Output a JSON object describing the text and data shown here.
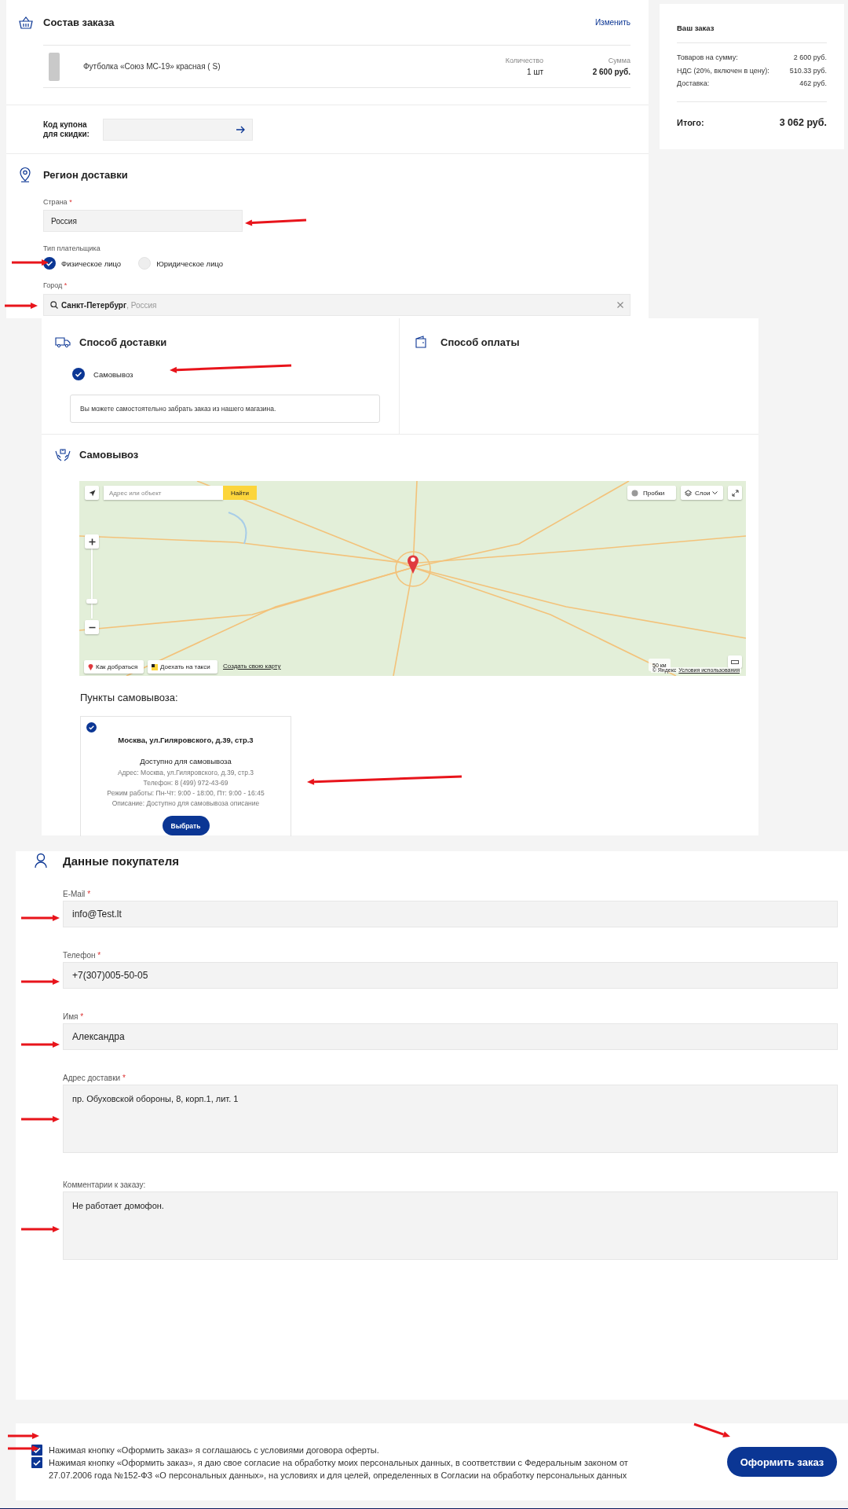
{
  "order": {
    "title": "Состав заказа",
    "edit_link": "Изменить",
    "items": [
      {
        "name": "Футболка «Союз МС-19» красная ( S)",
        "quantity_label": "Количество",
        "quantity": "1 шт",
        "sum_label": "Сумма",
        "sum": "2 600 руб."
      }
    ]
  },
  "coupon": {
    "label": "Код купона для скидки:"
  },
  "region": {
    "title": "Регион доставки",
    "country": {
      "label": "Страна",
      "required_mark": "*",
      "value": "Россия"
    },
    "payer_type": {
      "label": "Тип плательщика",
      "options": [
        {
          "label": "Физическое лицо",
          "selected": true
        },
        {
          "label": "Юридическое лицо",
          "selected": false
        }
      ]
    },
    "city": {
      "label": "Город",
      "required_mark": "*",
      "value": "Санкт-Петербург",
      "hint": ", Россия"
    }
  },
  "summary": {
    "title": "Ваш заказ",
    "rows": [
      {
        "label": "Товаров на сумму:",
        "value": "2 600 руб."
      },
      {
        "label": "НДС (20%, включен в цену):",
        "value": "510.33 руб."
      },
      {
        "label": "Доставка:",
        "value": "462 руб."
      }
    ],
    "total_label": "Итого:",
    "total": "3 062 руб."
  },
  "delivery": {
    "title": "Способ доставки",
    "options": [
      {
        "label": "Самовывоз",
        "selected": true
      }
    ],
    "description": "Вы можете самостоятельно забрать заказ из нашего магазина."
  },
  "payment": {
    "title": "Способ оплаты"
  },
  "pickup": {
    "title": "Самовывоз",
    "map": {
      "search_placeholder": "Адрес или объект",
      "search_button": "Найти",
      "traffic_button": "Пробки",
      "layers_button": "Слои",
      "route_button": "Как добраться",
      "taxi_button": "Доехать на такси",
      "create_map_link": "Создать свою карту",
      "scale": "50 км",
      "copyright": "© Яндекс",
      "terms_link": "Условия использования"
    },
    "points_title": "Пункты самовывоза:",
    "points": [
      {
        "selected": true,
        "name": "Москва, ул.Гиляровского, д.39, стр.3",
        "status": "Доступно для самовывоза",
        "lines": [
          "Адрес: Москва, ул.Гиляровского, д.39, стр.3",
          "Телефон: 8 (499) 972-43-69",
          "Режим работы: Пн-Чт: 9:00 - 18:00, Пт: 9:00 - 16:45",
          "Описание: Доступно для самовывоза описание"
        ],
        "button": "Выбрать"
      }
    ]
  },
  "buyer": {
    "title": "Данные покупателя",
    "fields": [
      {
        "kind": "input",
        "label": "E-Mail",
        "required_mark": "*",
        "value": "info@Test.lt"
      },
      {
        "kind": "input",
        "label": "Телефон",
        "required_mark": "*",
        "value": "+7(307)005-50-05"
      },
      {
        "kind": "input",
        "label": "Имя",
        "required_mark": "*",
        "value": "Александра"
      },
      {
        "kind": "textarea",
        "label": "Адрес доставки",
        "required_mark": "*",
        "value": "пр. Обуховской обороны, 8, корп.1, лит. 1"
      },
      {
        "kind": "textarea",
        "label": "Комментарии к заказу:",
        "value": "Не работает домофон."
      }
    ]
  },
  "consents": [
    {
      "checked": true,
      "text": "Нажимая кнопку «Оформить заказ» я соглашаюсь с условиями договора оферты."
    },
    {
      "checked": true,
      "text": "Нажимая кнопку «Оформить заказ», я даю свое согласие на обработку моих персональных данных, в соответствии с Федеральным законом от 27.07.2006 года №152-ФЗ «О персональных данных», на условиях и для целей, определенных в Согласии на обработку персональных данных"
    }
  ],
  "submit_button": "Оформить заказ"
}
